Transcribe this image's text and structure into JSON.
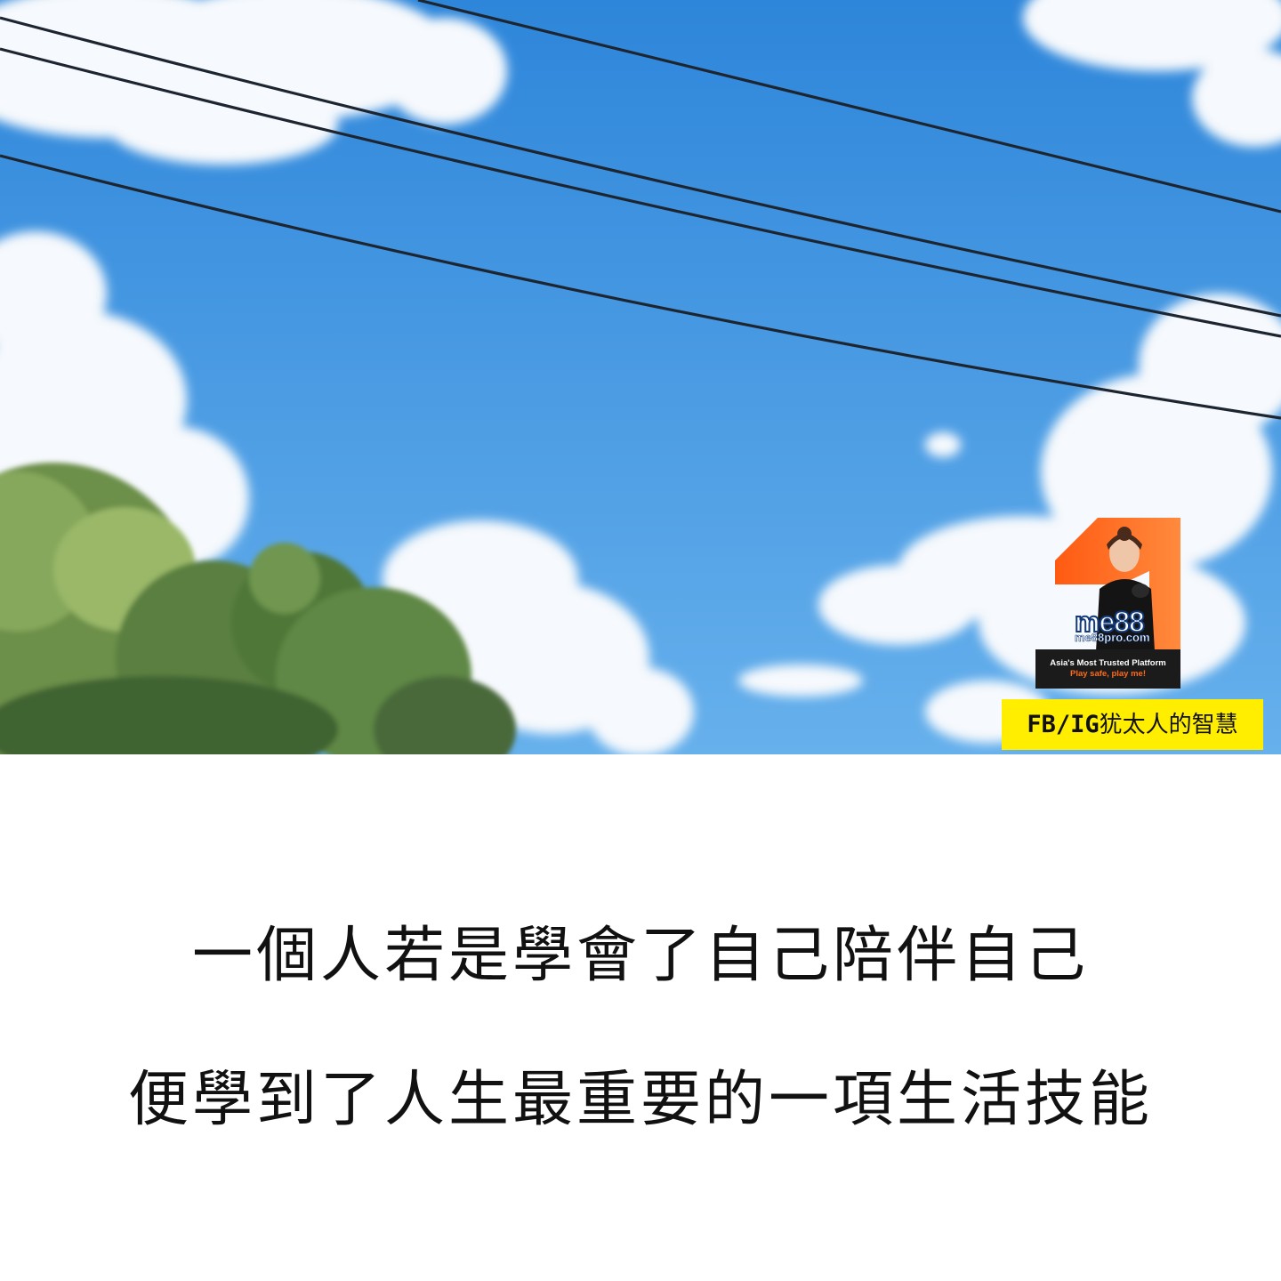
{
  "photo": {
    "subject": "sky-with-clouds-trees-and-power-lines",
    "sky_color": "#3f95e0"
  },
  "ad": {
    "brand": "me88",
    "site": "me88pro.com",
    "tagline": "Asia's Most Trusted Platform",
    "slogan": "Play safe, play me!",
    "accent_color": "#ff6a1a"
  },
  "watermark": {
    "prefix": "FB/IG",
    "name": "犹太人的智慧",
    "background": "#ffee00"
  },
  "caption": {
    "line1": "一個人若是學會了自己陪伴自己",
    "line2": "便學到了人生最重要的一項生活技能"
  }
}
